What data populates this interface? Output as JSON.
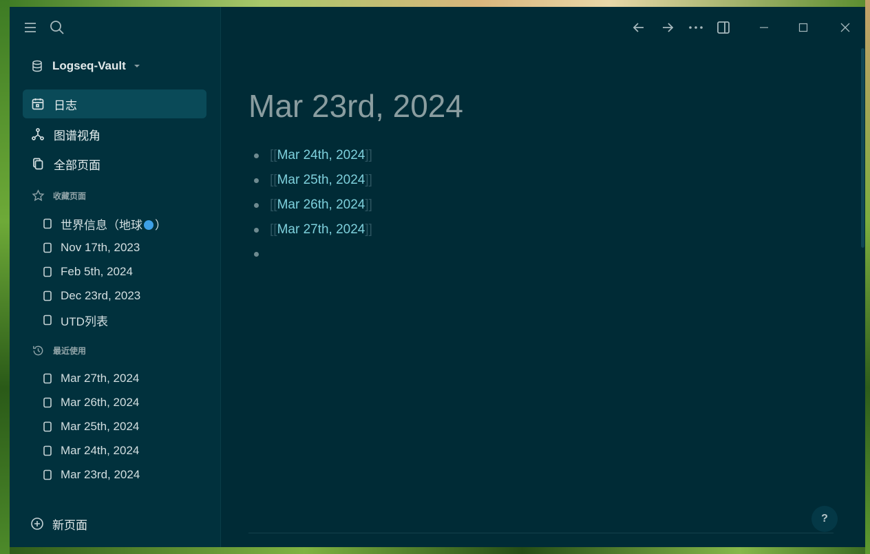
{
  "graph": {
    "name": "Logseq-Vault"
  },
  "nav": [
    {
      "label": "日志",
      "icon": "calendar-icon",
      "active": true
    },
    {
      "label": "图谱视角",
      "icon": "graph-icon",
      "active": false
    },
    {
      "label": "全部页面",
      "icon": "pages-icon",
      "active": false
    }
  ],
  "favorites": {
    "header": "收藏页面",
    "items": [
      {
        "label_a": "世界信息（地球",
        "label_b": "）"
      },
      {
        "label": "Nov 17th, 2023"
      },
      {
        "label": "Feb 5th, 2024"
      },
      {
        "label": "Dec 23rd, 2023"
      },
      {
        "label": "UTD列表"
      }
    ]
  },
  "recent": {
    "header": "最近使用",
    "items": [
      {
        "label": "Mar 27th, 2024"
      },
      {
        "label": "Mar 26th, 2024"
      },
      {
        "label": "Mar 25th, 2024"
      },
      {
        "label": "Mar 24th, 2024"
      },
      {
        "label": "Mar 23rd, 2024"
      }
    ]
  },
  "new_page": {
    "label": "新页面"
  },
  "page": {
    "title": "Mar 23rd, 2024",
    "blocks": [
      {
        "open": "[[",
        "ref": "Mar 24th, 2024",
        "close": "]]"
      },
      {
        "open": "[[",
        "ref": "Mar 25th, 2024",
        "close": "]]"
      },
      {
        "open": "[[",
        "ref": "Mar 26th, 2024",
        "close": "]]"
      },
      {
        "open": "[[",
        "ref": "Mar 27th, 2024",
        "close": "]]"
      },
      {
        "open": "",
        "ref": "",
        "close": ""
      }
    ]
  },
  "help": {
    "label": "?"
  },
  "colors": {
    "window_bg": "#002b36",
    "sidebar_bg": "#01313d",
    "active_item_bg": "#0a4a58",
    "link": "#7ed0dc",
    "title": "#8a9da0"
  }
}
